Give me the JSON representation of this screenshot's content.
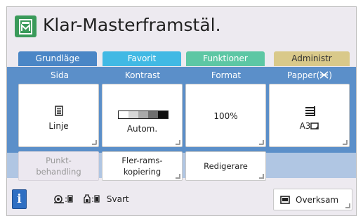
{
  "header": {
    "title": "Klar-Masterframstäl."
  },
  "tabs": [
    {
      "label": "Grundläge",
      "active": true,
      "color": "#4a86c6"
    },
    {
      "label": "Favorit",
      "active": false,
      "color": "#41b9e4"
    },
    {
      "label": "Funktioner",
      "active": false,
      "color": "#5dc7a4"
    },
    {
      "label": "Administr",
      "active": false,
      "color": "#d9c98a"
    }
  ],
  "settings": {
    "page": {
      "label": "Sida",
      "value": "Linje",
      "icon": "document-lines-icon"
    },
    "contrast": {
      "label": "Kontrast",
      "value": "Autom.",
      "icon": "contrast-scale-icon"
    },
    "format": {
      "label": "Format",
      "value": "100%"
    },
    "paper": {
      "label": "Papper(",
      "label_suffix": ")",
      "value": "A3",
      "icon": "paper-stack-icon",
      "label_icon": "x-tray-icon"
    }
  },
  "buttons": {
    "dot_processing": {
      "label": "Punkt-\nbehandling",
      "disabled": true
    },
    "multi_up": {
      "label": "Fler-rams-\nkopiering",
      "disabled": false
    },
    "editor": {
      "label": "Redigerare",
      "disabled": false
    }
  },
  "footer": {
    "info_label": "i",
    "drum_icon": "drum-icon",
    "ink_icon": "ink-bottle-icon",
    "ink_color": "Svart",
    "idle_label": "Overksam"
  },
  "colors": {
    "panel_blue": "#5b8fc9",
    "strip_blue": "#b0c6e3",
    "master_green": "#3a9a5a"
  }
}
